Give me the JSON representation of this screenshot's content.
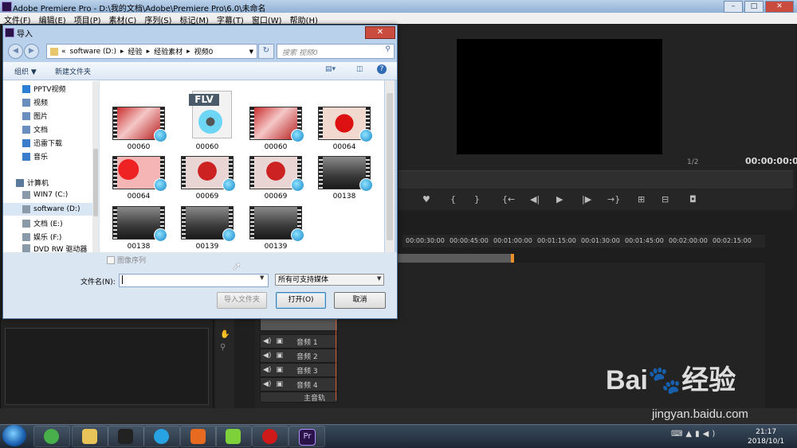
{
  "app": {
    "title": "Adobe Premiere Pro - D:\\我的文档\\Adobe\\Premiere Pro\\6.0\\未命名",
    "window_controls": [
      "–",
      "□",
      "✕"
    ],
    "menu": [
      "文件(F)",
      "编辑(E)",
      "项目(P)",
      "素材(C)",
      "序列(S)",
      "标记(M)",
      "字幕(T)",
      "窗口(W)",
      "帮助(H)"
    ]
  },
  "monitor": {
    "timecode": "00:00:00:00",
    "fraction": "1/2"
  },
  "timeline": {
    "ruler_ticks": [
      "00:00:30:00",
      "00:00:45:00",
      "00:01:00:00",
      "00:01:15:00",
      "00:01:30:00",
      "00:01:45:00",
      "00:02:00:00",
      "00:02:15:00"
    ],
    "audio_tracks": [
      "音频 1",
      "音频 2",
      "音频 3",
      "音频 4",
      "主音轨"
    ]
  },
  "dialog": {
    "title": "导入",
    "close": "✕",
    "address": {
      "prefix": "«",
      "path": [
        "software (D:)",
        "经验",
        "经验素材",
        "视频0"
      ]
    },
    "search_placeholder": "搜索 视频0",
    "toolbar": {
      "organize": "组织 ▼",
      "new_folder": "新建文件夹"
    },
    "nav": [
      {
        "label": "PPTV视频",
        "color": "#2a7fd4"
      },
      {
        "label": "视频",
        "color": "#6a8fbf"
      },
      {
        "label": "图片",
        "color": "#6a8fbf"
      },
      {
        "label": "文档",
        "color": "#6a8fbf"
      },
      {
        "label": "迅雷下载",
        "color": "#3a7ecc"
      },
      {
        "label": "音乐",
        "color": "#3a7ecc"
      },
      {
        "label": "计算机",
        "color": "#5a7a9c"
      },
      {
        "label": "WIN7 (C:)",
        "color": "#8a9aa8"
      },
      {
        "label": "software (D:)",
        "color": "#8a9aa8"
      },
      {
        "label": "文档 (E:)",
        "color": "#8a9aa8"
      },
      {
        "label": "娱乐 (F:)",
        "color": "#8a9aa8"
      },
      {
        "label": "DVD RW 驱动器",
        "color": "#8a9aa8"
      }
    ],
    "files": [
      {
        "name": "00060",
        "type": "red-wedding",
        "badge": true
      },
      {
        "name": "00060",
        "type": "flv",
        "badge": false
      },
      {
        "name": "00060",
        "type": "red-wedding",
        "badge": true
      },
      {
        "name": "00064",
        "type": "red-symbol",
        "badge": true
      },
      {
        "name": "00064",
        "type": "red-flowers",
        "badge": true
      },
      {
        "name": "00069",
        "type": "red-ball",
        "badge": true
      },
      {
        "name": "00069",
        "type": "red-ball",
        "badge": true
      },
      {
        "name": "00138",
        "type": "car",
        "badge": true
      },
      {
        "name": "00138",
        "type": "car",
        "badge": true
      },
      {
        "name": "00139",
        "type": "car",
        "badge": true
      },
      {
        "name": "00139",
        "type": "car",
        "badge": true
      }
    ],
    "flv_label": "FLV",
    "image_sequence": "图像序列",
    "filename_label": "文件名(N):",
    "filename_value": "",
    "filetype": "所有可支持媒体",
    "buttons": {
      "import_folder": "导入文件夹",
      "open": "打开(O)",
      "cancel": "取消"
    }
  },
  "taskbar": {
    "apps": [
      {
        "name": "360-browser",
        "color": "#47b04a"
      },
      {
        "name": "explorer",
        "color": "#e7c35a"
      },
      {
        "name": "qq",
        "color": "#222222"
      },
      {
        "name": "pptv",
        "color": "#27a3e3"
      },
      {
        "name": "firefox",
        "color": "#e66a1f"
      },
      {
        "name": "media-player",
        "color": "#7fd13b"
      },
      {
        "name": "recorder",
        "color": "#d01919"
      },
      {
        "name": "premiere",
        "color": "#2a1348"
      }
    ],
    "time": "21:17",
    "date": "2018/10/1"
  },
  "watermark": {
    "brand": "Bai🐾经验",
    "url": "jingyan.baidu.com"
  }
}
